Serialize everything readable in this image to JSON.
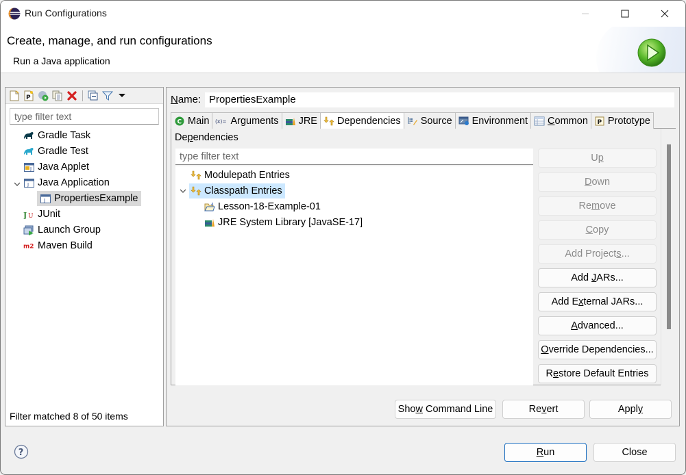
{
  "window": {
    "title": "Run Configurations",
    "controls": [
      "minimize",
      "maximize",
      "close"
    ]
  },
  "banner": {
    "title": "Create, manage, and run configurations",
    "subtitle": "Run a Java application",
    "icon": "run-icon"
  },
  "left_panel": {
    "toolbar": [
      {
        "name": "new-launch-configuration",
        "icon": "new-file-icon"
      },
      {
        "name": "new-prototype",
        "icon": "new-prototype-icon"
      },
      {
        "name": "export",
        "icon": "export-icon"
      },
      {
        "name": "duplicate",
        "icon": "duplicate-icon"
      },
      {
        "name": "delete",
        "icon": "delete-icon"
      },
      {
        "name": "collapse-all",
        "icon": "collapse-icon"
      },
      {
        "name": "filter",
        "icon": "filter-icon"
      },
      {
        "name": "view-menu",
        "icon": "dropdown-icon"
      }
    ],
    "filter_placeholder": "type filter text",
    "tree": [
      {
        "label": "Gradle Task",
        "icon": "gradle-task-icon"
      },
      {
        "label": "Gradle Test",
        "icon": "gradle-test-icon"
      },
      {
        "label": "Java Applet",
        "icon": "java-applet-icon"
      },
      {
        "label": "Java Application",
        "icon": "java-application-icon",
        "expanded": true
      },
      {
        "label": "PropertiesExample",
        "icon": "java-application-icon",
        "selected": true
      },
      {
        "label": "JUnit",
        "icon": "junit-icon"
      },
      {
        "label": "Launch Group",
        "icon": "launch-group-icon"
      },
      {
        "label": "Maven Build",
        "icon": "maven-icon"
      }
    ],
    "status": "Filter matched 8 of 50 items"
  },
  "right_panel": {
    "name_label_prefix": "N",
    "name_label_rest": "ame:",
    "name_value": "PropertiesExample",
    "tabs": [
      {
        "label": "Main",
        "icon": "main-icon"
      },
      {
        "label": "Arguments",
        "icon": "arguments-icon"
      },
      {
        "label": "JRE",
        "icon": "jre-icon"
      },
      {
        "label": "Dependencies",
        "icon": "dependencies-icon",
        "active": true
      },
      {
        "label": "Source",
        "icon": "source-icon"
      },
      {
        "label": "Environment",
        "icon": "environment-icon"
      },
      {
        "label": "Common",
        "icon": "common-icon"
      },
      {
        "label": "Prototype",
        "icon": "prototype-icon"
      }
    ],
    "dependencies": {
      "label_a": "De",
      "label_b": "p",
      "label_c": "endencies",
      "filter_placeholder": "type filter text",
      "tree": [
        {
          "label": "Modulepath Entries",
          "icon": "modulepath-icon"
        },
        {
          "label": "Classpath Entries",
          "icon": "classpath-icon",
          "expanded": true,
          "selected": true
        },
        {
          "label": "Lesson-18-Example-01",
          "icon": "project-folder-icon"
        },
        {
          "label": "JRE System Library [JavaSE-17]",
          "icon": "library-icon"
        }
      ],
      "buttons": [
        {
          "pre": "U",
          "u": "p",
          "post": "",
          "enabled": false
        },
        {
          "pre": "",
          "u": "D",
          "post": "own",
          "enabled": false
        },
        {
          "pre": "Re",
          "u": "m",
          "post": "ove",
          "enabled": false
        },
        {
          "pre": "",
          "u": "C",
          "post": "opy",
          "enabled": false
        },
        {
          "pre": "Add Project",
          "u": "s",
          "post": "...",
          "enabled": false
        },
        {
          "pre": "Add ",
          "u": "J",
          "post": "ARs...",
          "enabled": true
        },
        {
          "pre": "Add E",
          "u": "x",
          "post": "ternal JARs...",
          "enabled": true
        },
        {
          "pre": "",
          "u": "A",
          "post": "dvanced...",
          "enabled": true
        },
        {
          "pre": "",
          "u": "O",
          "post": "verride Dependencies...",
          "enabled": true
        },
        {
          "pre": "R",
          "u": "e",
          "post": "store Default Entries",
          "enabled": true
        }
      ]
    },
    "actions": {
      "show_command_line": {
        "pre": "Sho",
        "u": "w",
        "post": " Command Line"
      },
      "revert": {
        "pre": "Re",
        "u": "v",
        "post": "ert"
      },
      "apply": {
        "pre": "Appl",
        "u": "y",
        "post": ""
      }
    }
  },
  "footer": {
    "help_icon": "help-icon",
    "run": {
      "pre": "",
      "u": "R",
      "post": "un"
    },
    "close": "Close"
  },
  "colors": {
    "selection_left": "#d9d9d9",
    "selection_dep": "#cce8ff",
    "run_button_border": "#1a6dbf",
    "disabled_text": "#8a8a8a"
  }
}
